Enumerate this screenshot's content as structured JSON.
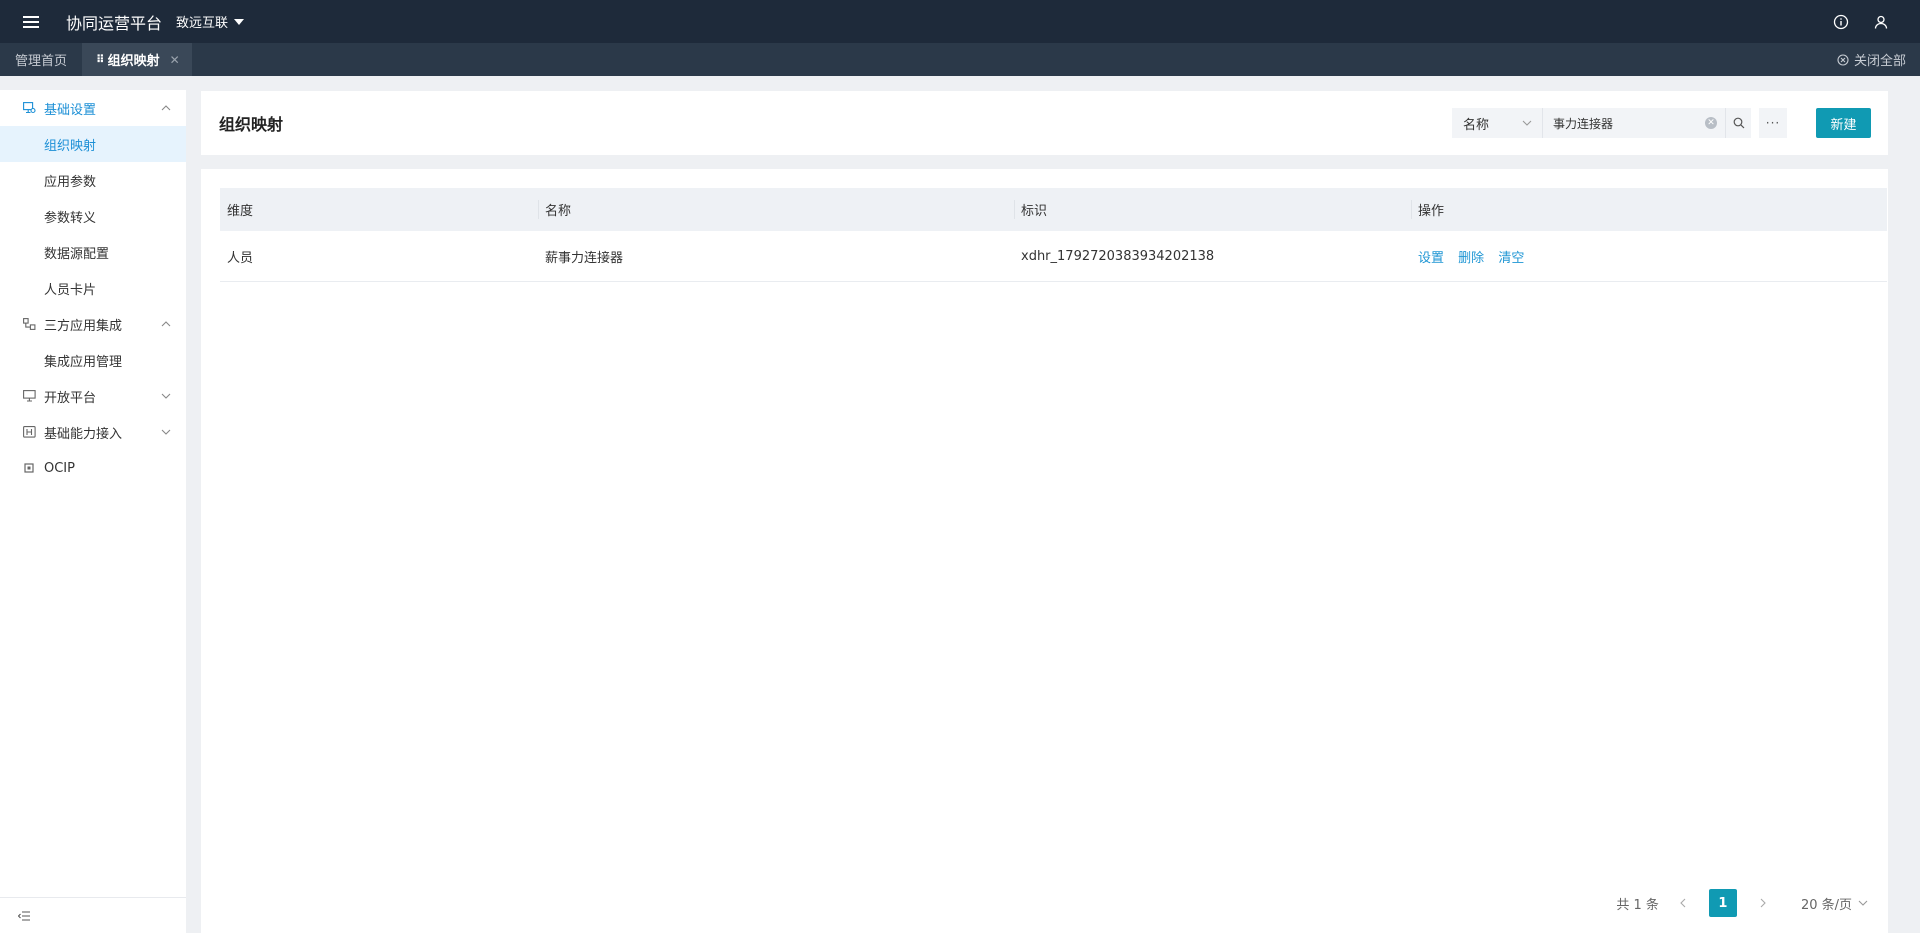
{
  "topbar": {
    "app_title": "协同运营平台",
    "org_name": "致远互联"
  },
  "tabs": {
    "home": "管理首页",
    "active": "组织映射",
    "close_all": "关闭全部"
  },
  "sidebar": {
    "groups": [
      {
        "label": "基础设置",
        "icon": "monitor-settings-icon",
        "expanded": true,
        "items": [
          "组织映射",
          "应用参数",
          "参数转义",
          "数据源配置",
          "人员卡片"
        ]
      },
      {
        "label": "三方应用集成",
        "icon": "integration-icon",
        "expanded": true,
        "items": [
          "集成应用管理"
        ]
      },
      {
        "label": "开放平台",
        "icon": "monitor-icon",
        "expanded": false,
        "items": []
      },
      {
        "label": "基础能力接入",
        "icon": "capability-icon",
        "expanded": false,
        "items": []
      },
      {
        "label": "OCIP",
        "icon": "ocip-icon",
        "expanded": false,
        "items": []
      }
    ],
    "active_item": "组织映射"
  },
  "header": {
    "title": "组织映射",
    "search_field": "名称",
    "search_value": "事力连接器",
    "more_label": "···",
    "new_label": "新建"
  },
  "table": {
    "columns": [
      "维度",
      "名称",
      "标识",
      "操作"
    ],
    "rows": [
      {
        "dimension": "人员",
        "name": "薪事力连接器",
        "id": "xdhr_1792720383934202138",
        "actions": [
          "设置",
          "删除",
          "清空"
        ]
      }
    ]
  },
  "pagination": {
    "total_text": "共 1 条",
    "current_page": "1",
    "page_size": "20 条/页"
  },
  "colors": {
    "topbar": "#1e2a3a",
    "tabbar": "#2b3949",
    "accent": "#109ab3",
    "link": "#1f96d4",
    "sidebar_active": "#1b8fd6"
  }
}
